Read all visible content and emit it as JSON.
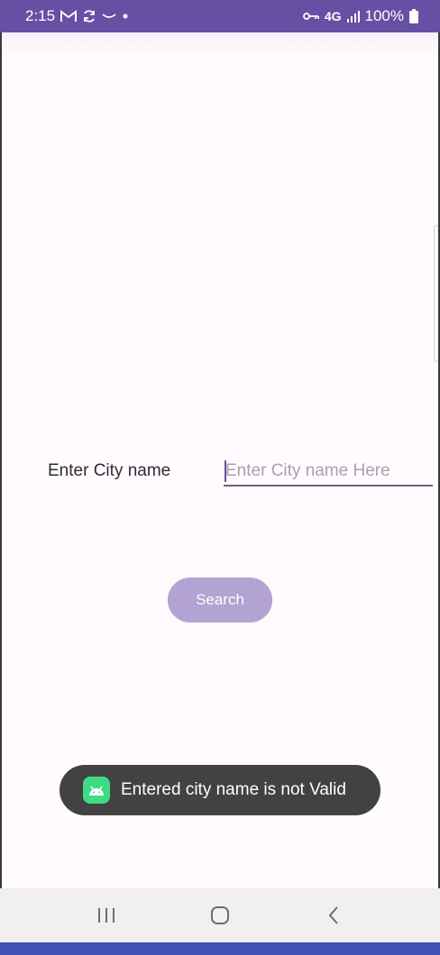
{
  "status_bar": {
    "time": "2:15",
    "network": "4G",
    "battery": "100%",
    "icons": [
      "gmail-icon",
      "sync-icon",
      "amazon-icon",
      "dot-icon",
      "vpn-key-icon",
      "signal-icon",
      "battery-icon"
    ]
  },
  "form": {
    "label": "Enter City name",
    "input_value": "",
    "input_placeholder": "Enter City name Here",
    "search_button": "Search"
  },
  "toast": {
    "message": "Entered city name is not Valid",
    "icon": "android-icon"
  },
  "nav_bar": {
    "icons": [
      "recent-apps-icon",
      "home-icon",
      "back-icon"
    ]
  },
  "colors": {
    "accent": "#6750a4",
    "button": "#b2a3d2",
    "toast_bg": "#424242",
    "android_green": "#3ddc84"
  }
}
